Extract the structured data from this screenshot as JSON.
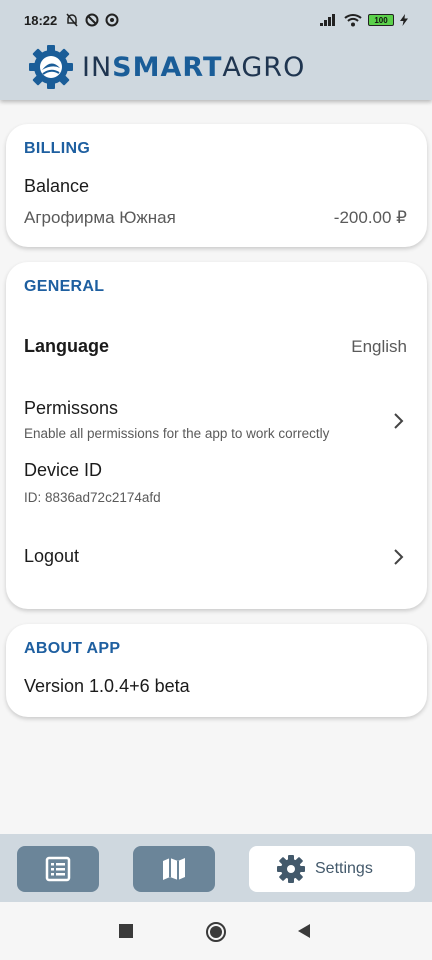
{
  "status_bar": {
    "time": "18:22",
    "battery": "100",
    "icons": [
      "bell-off-icon",
      "do-not-disturb-icon",
      "data-saver-icon",
      "signal-icon",
      "wifi-icon",
      "battery-icon",
      "charging-icon"
    ]
  },
  "header": {
    "logo_prefix": "IN",
    "logo_bold": "SMART",
    "logo_suffix": "AGRO"
  },
  "billing": {
    "section_title": "BILLING",
    "balance_label": "Balance",
    "company": "Агрофирма Южная",
    "amount": "-200.00 ₽"
  },
  "general": {
    "section_title": "GENERAL",
    "language_label": "Language",
    "language_value": "English",
    "permissions_label": "Permissons",
    "permissions_desc": "Enable all permissions for the app to work correctly",
    "device_id_label": "Device ID",
    "device_id_value": "ID: 8836ad72c2174afd",
    "logout_label": "Logout"
  },
  "about": {
    "section_title": "ABOUT APP",
    "version": "Version 1.0.4+6 beta"
  },
  "bottom_nav": {
    "items": [
      {
        "icon": "list-icon",
        "label": ""
      },
      {
        "icon": "map-icon",
        "label": ""
      },
      {
        "icon": "gear-icon",
        "label": "Settings"
      }
    ]
  },
  "colors": {
    "header_bg": "#cfd8df",
    "accent": "#1e5fa0",
    "nav_button": "#6b8599"
  }
}
